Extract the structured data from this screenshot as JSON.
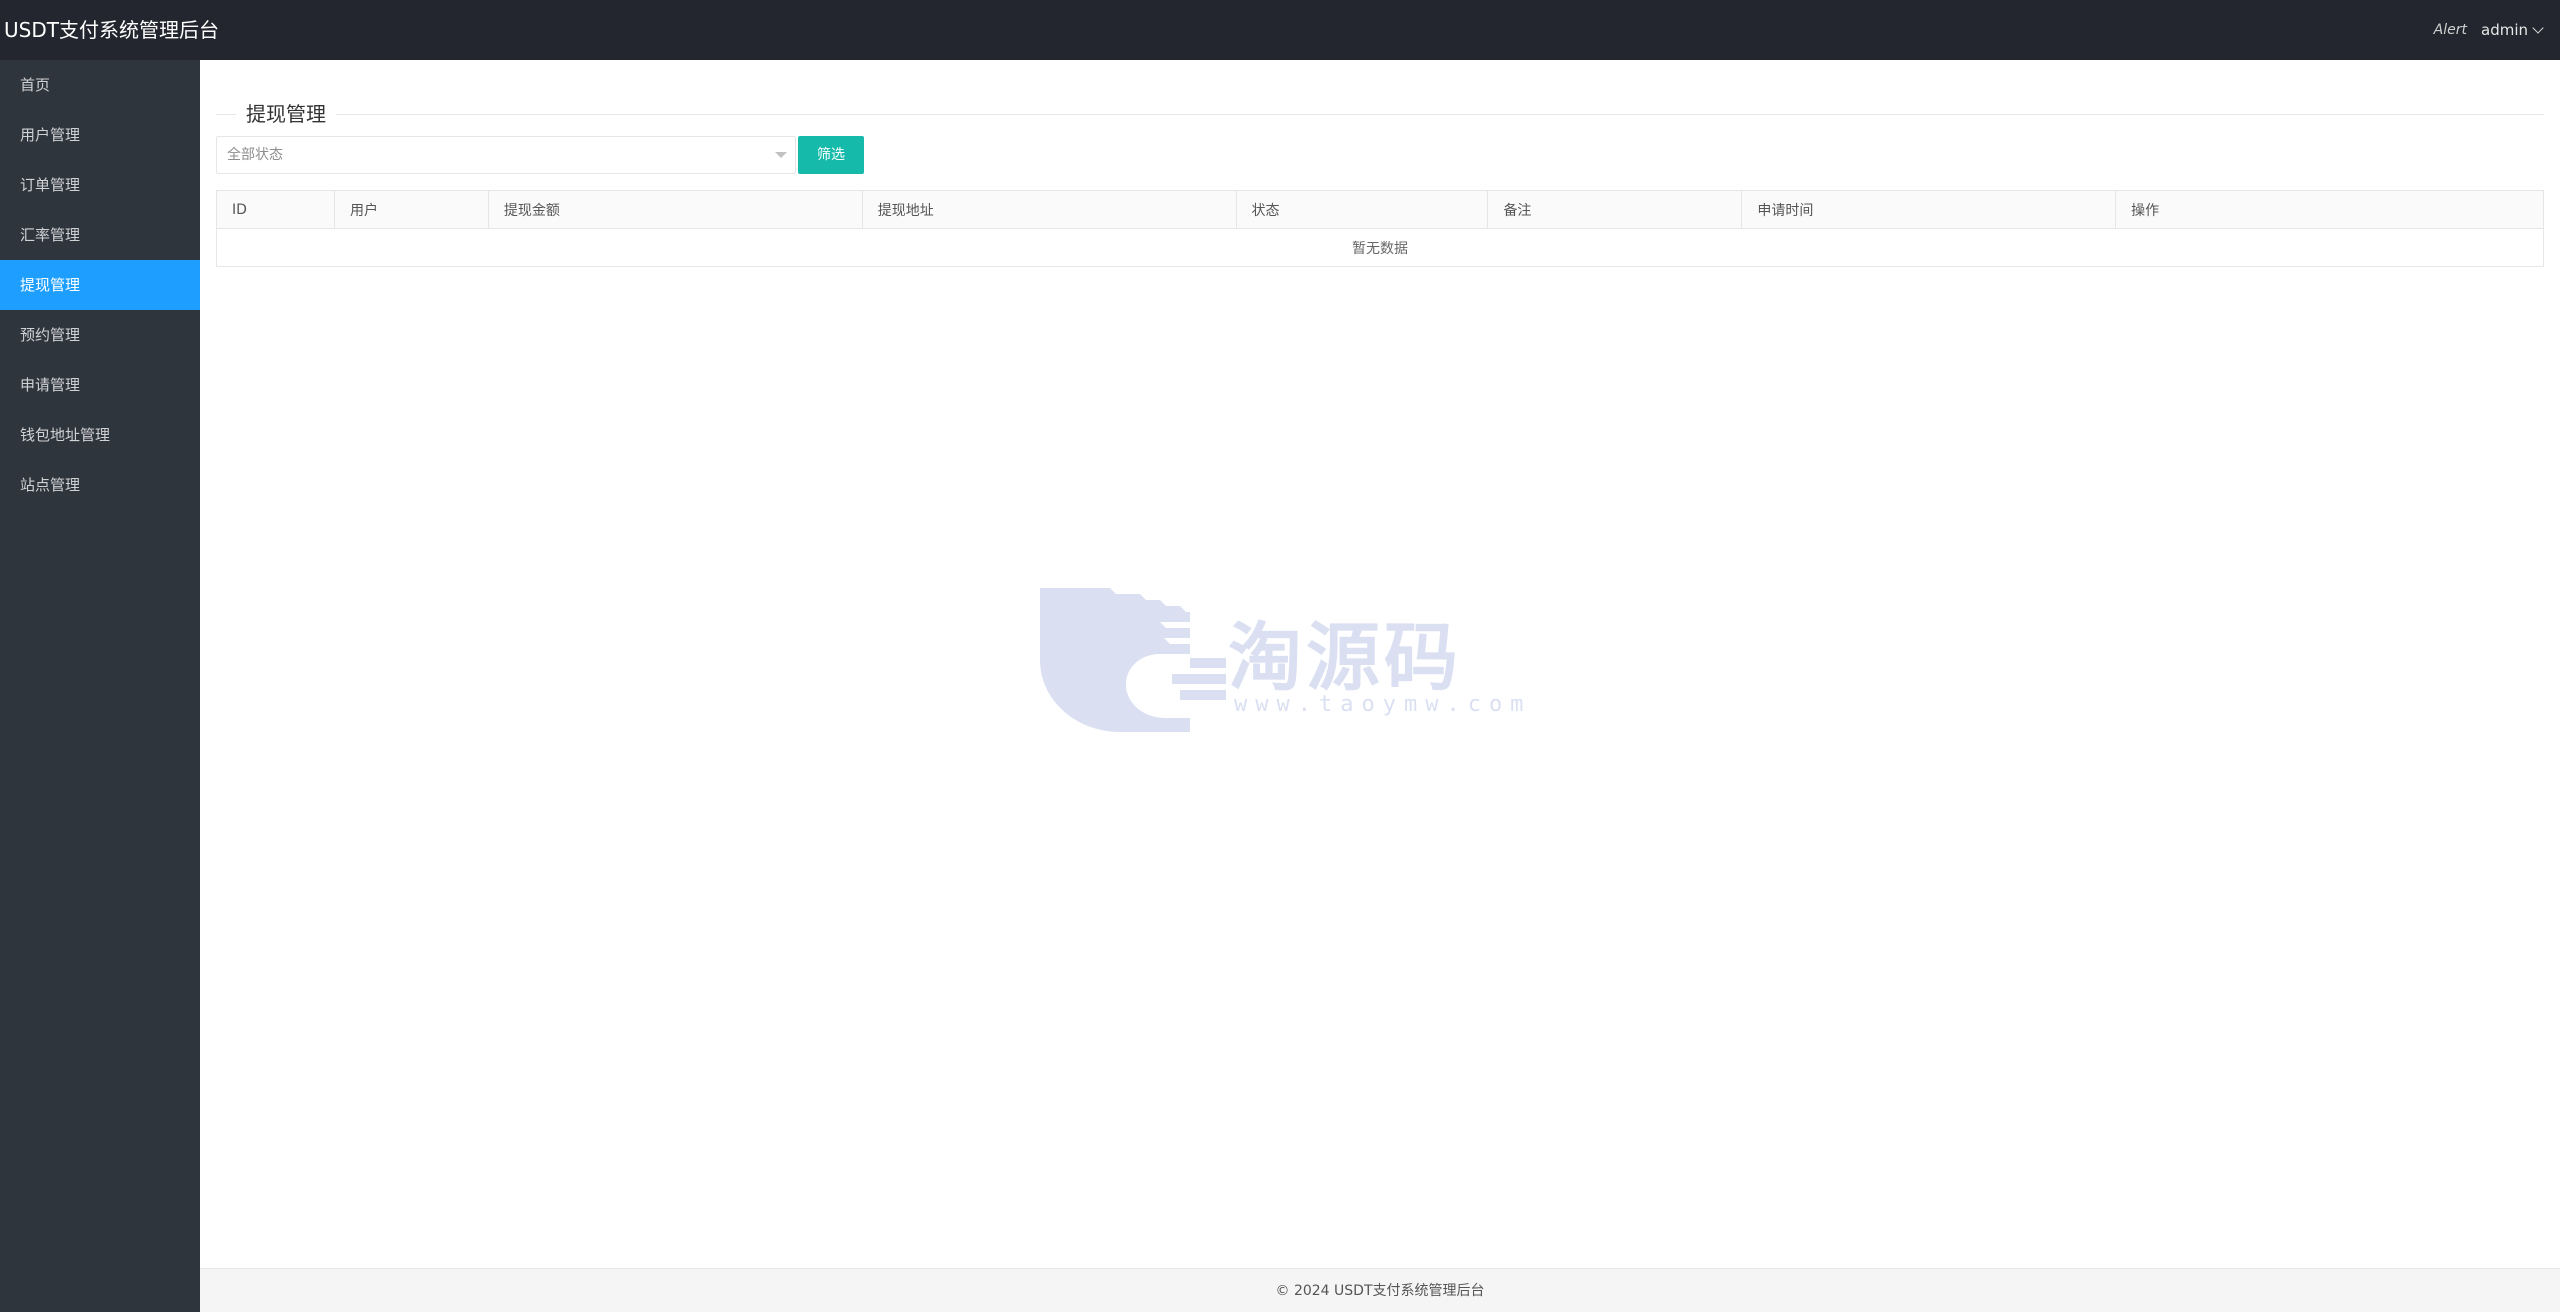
{
  "header": {
    "title": "USDT支付系统管理后台",
    "notice": "Alert",
    "user": "admin"
  },
  "sidebar": {
    "items": [
      {
        "label": "首页"
      },
      {
        "label": "用户管理"
      },
      {
        "label": "订单管理"
      },
      {
        "label": "汇率管理"
      },
      {
        "label": "提现管理",
        "active": true
      },
      {
        "label": "预约管理"
      },
      {
        "label": "申请管理"
      },
      {
        "label": "钱包地址管理"
      },
      {
        "label": "站点管理"
      }
    ]
  },
  "main": {
    "section_title": "提现管理",
    "filter": {
      "selected": "全部状态",
      "button_label": "筛选"
    },
    "table": {
      "columns": [
        "ID",
        "用户",
        "提现金额",
        "提现地址",
        "状态",
        "备注",
        "申请时间",
        "操作"
      ],
      "empty_text": "暂无数据"
    }
  },
  "watermark": {
    "text": "淘源码",
    "url": "www.taoymw.com"
  },
  "footer": {
    "text": "© 2024 USDT支付系统管理后台"
  },
  "colors": {
    "header_bg": "#23262e",
    "sidebar_bg": "#2f353c",
    "active_nav": "#1e9fff",
    "button": "#16baaa"
  }
}
